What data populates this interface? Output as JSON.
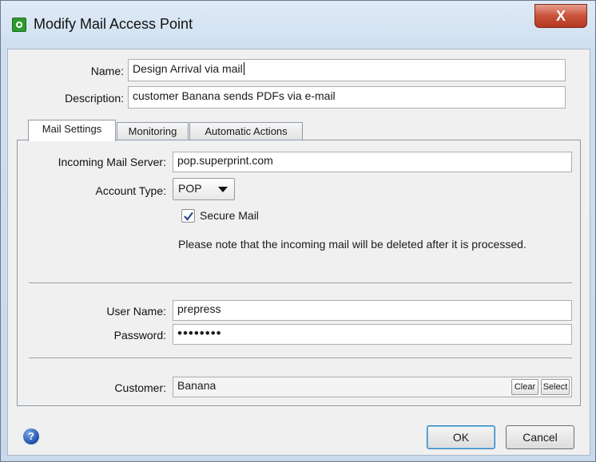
{
  "window": {
    "title": "Modify Mail Access Point",
    "close_label": "X"
  },
  "header": {
    "name_label": "Name:",
    "name_value": "Design Arrival via mail",
    "description_label": "Description:",
    "description_value": "customer Banana sends PDFs via e-mail"
  },
  "tabs": [
    {
      "label": "Mail Settings",
      "active": true
    },
    {
      "label": "Monitoring",
      "active": false
    },
    {
      "label": "Automatic Actions",
      "active": false
    }
  ],
  "mail_settings": {
    "server_label": "Incoming Mail Server:",
    "server_value": "pop.superprint.com",
    "account_type_label": "Account Type:",
    "account_type_value": "POP",
    "secure_label": "Secure Mail",
    "secure_checked": true,
    "note": "Please note that the incoming mail will be deleted after it is processed.",
    "username_label": "User Name:",
    "username_value": "prepress",
    "password_label": "Password:",
    "password_value": "••••••••",
    "customer_label": "Customer:",
    "customer_value": "Banana",
    "clear_label": "Clear",
    "select_label": "Select"
  },
  "footer": {
    "help_icon": "?",
    "ok_label": "OK",
    "cancel_label": "Cancel"
  }
}
